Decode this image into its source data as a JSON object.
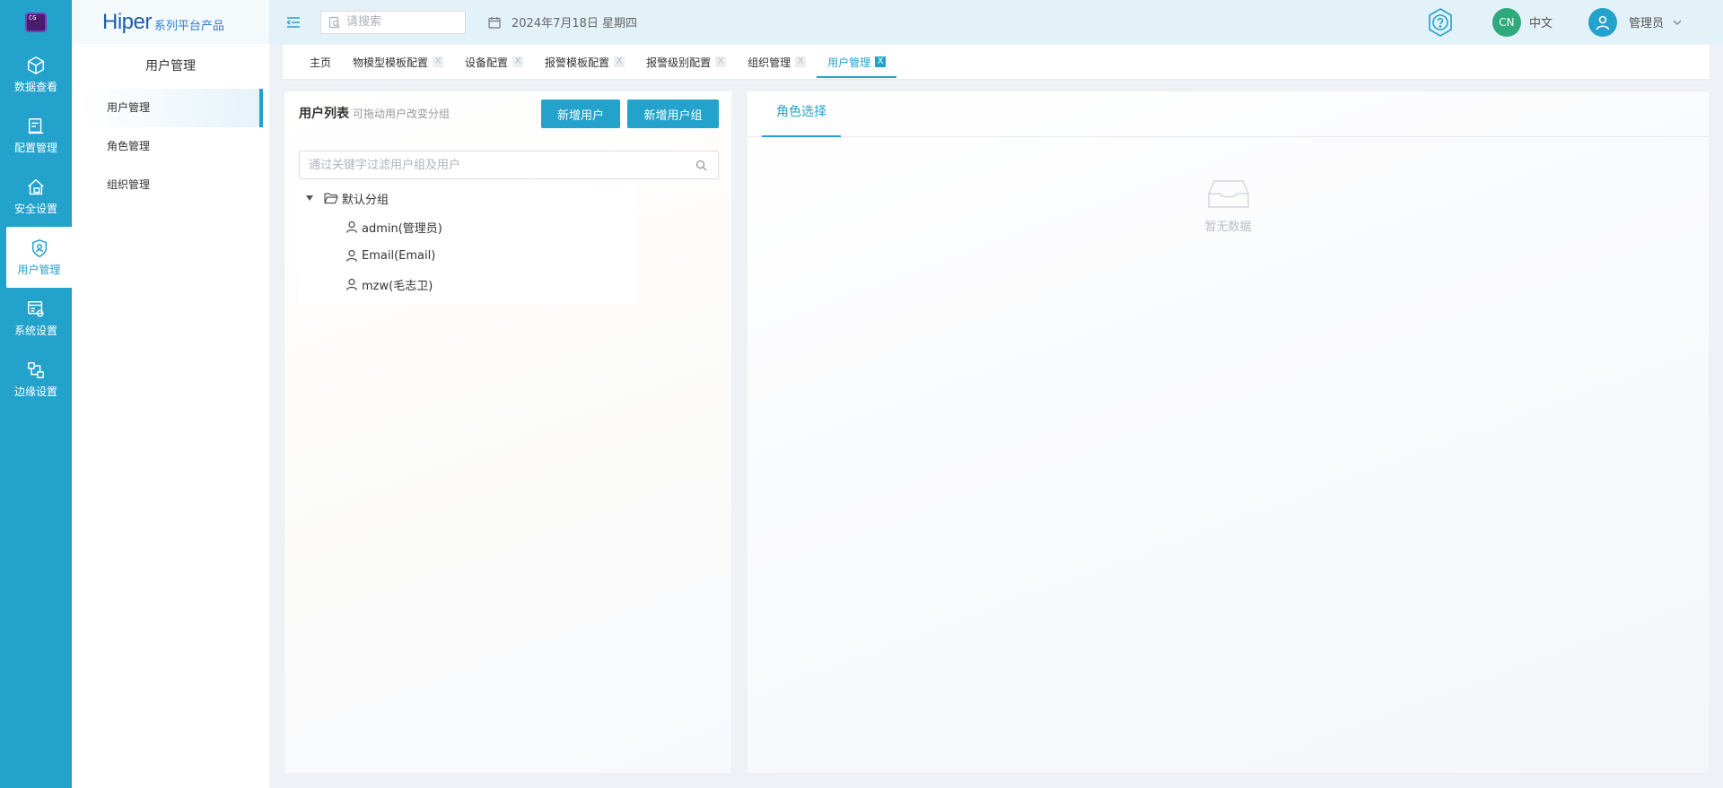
{
  "rail": {
    "logo_text": "CG",
    "items": [
      {
        "label": "数据查看",
        "icon": "cube-icon"
      },
      {
        "label": "配置管理",
        "icon": "config-icon"
      },
      {
        "label": "安全设置",
        "icon": "security-icon"
      },
      {
        "label": "用户管理",
        "icon": "user-shield-icon",
        "active": true
      },
      {
        "label": "系统设置",
        "icon": "system-settings-icon"
      },
      {
        "label": "边缘设置",
        "icon": "edge-icon"
      }
    ]
  },
  "brand": {
    "name": "Hiper",
    "subtitle": "系列平台产品"
  },
  "sidebar": {
    "title": "用户管理",
    "items": [
      {
        "label": "用户管理",
        "active": true
      },
      {
        "label": "角色管理"
      },
      {
        "label": "组织管理"
      }
    ]
  },
  "topbar": {
    "search_placeholder": "请搜索",
    "date": "2024年7月18日 星期四",
    "lang_badge": "CN",
    "lang_label": "中文",
    "user_label": "管理员"
  },
  "tabs": [
    {
      "label": "主页",
      "closable": false
    },
    {
      "label": "物模型模板配置",
      "closable": true
    },
    {
      "label": "设备配置",
      "closable": true
    },
    {
      "label": "报警模板配置",
      "closable": true
    },
    {
      "label": "报警级别配置",
      "closable": true
    },
    {
      "label": "组织管理",
      "closable": true
    },
    {
      "label": "用户管理",
      "closable": true,
      "active": true
    }
  ],
  "tab_close_glyph": "X",
  "user_panel": {
    "title": "用户列表",
    "hint": "可拖动用户改变分组",
    "add_user_label": "新增用户",
    "add_group_label": "新增用户组",
    "filter_placeholder": "通过关键字过滤用户组及用户",
    "group_name": "默认分组",
    "users": [
      "admin(管理员)",
      "Email(Email)",
      "mzw(毛志卫)"
    ]
  },
  "role_panel": {
    "tab_label": "角色选择",
    "empty_text": "暂无数据"
  },
  "colors": {
    "accent": "#23a2cc",
    "lang_badge": "#2eaa7c"
  }
}
